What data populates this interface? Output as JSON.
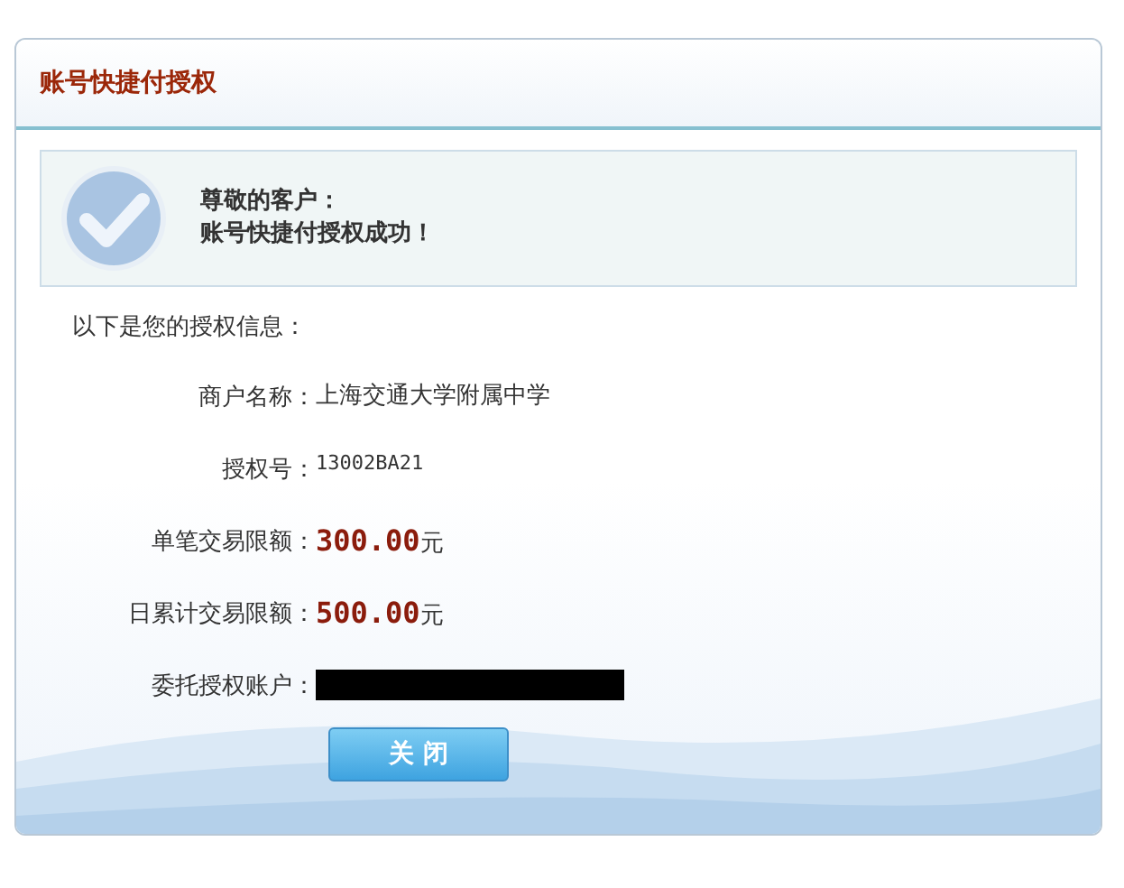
{
  "title": "账号快捷付授权",
  "message": {
    "greeting": "尊敬的客户：",
    "text": "账号快捷付授权成功！"
  },
  "intro": "以下是您的授权信息：",
  "fields": [
    {
      "kind": "text",
      "label": "商户名称：",
      "value": "上海交通大学附属中学"
    },
    {
      "kind": "code",
      "label": "授权号：",
      "value": "13002BA21"
    },
    {
      "kind": "amount",
      "label": "单笔交易限额：",
      "value": "300.00",
      "unit": "元"
    },
    {
      "kind": "amount",
      "label": "日累计交易限额：",
      "value": "500.00",
      "unit": "元"
    },
    {
      "kind": "redacted",
      "label": "委托授权账户："
    }
  ],
  "button": "关 闭"
}
